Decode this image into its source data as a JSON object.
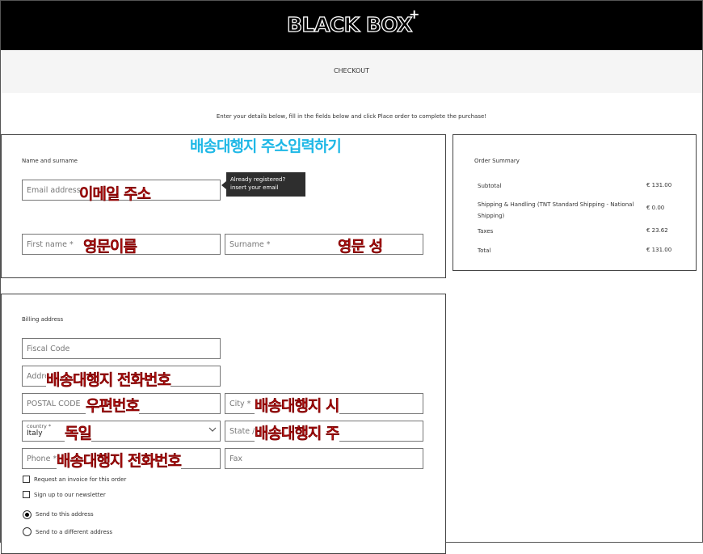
{
  "header": {
    "logo": "BLACK BOX",
    "logo_plus": "+"
  },
  "subbar": {
    "title": "CHECKOUT"
  },
  "intro": "Enter your details below, fill in the fields below and click Place order to complete the purchase!",
  "contact": {
    "section_label": "Name and surname",
    "email_placeholder": "Email address",
    "tooltip_line1": "Already registered?",
    "tooltip_line2": "insert your email",
    "first_name_placeholder": "First name *",
    "surname_placeholder": "Surname *"
  },
  "billing": {
    "section_label": "Billing address",
    "fiscal_code_placeholder": "Fiscal Code",
    "address_placeholder": "Addre",
    "postal_placeholder": "POSTAL CODE",
    "city_placeholder": "City *",
    "country_label": "country *",
    "country_value": "Italy",
    "state_placeholder": "State /",
    "phone_placeholder": "Phone *",
    "fax_placeholder": "Fax",
    "invoice_label": "Request an invoice for this order",
    "newsletter_label": "Sign up to our newsletter",
    "send_same_label": "Send to this address",
    "send_different_label": "Send to a different address"
  },
  "summary": {
    "title": "Order Summary",
    "rows": [
      {
        "label": "Subtotal",
        "value": "€ 131.00"
      },
      {
        "label": "Shipping & Handling (TNT Standard Shipping - National Shipping)",
        "value": "€ 0.00"
      },
      {
        "label": "Taxes",
        "value": "€ 23.62"
      },
      {
        "label": "Total",
        "value": "€ 131.00"
      }
    ]
  },
  "annotations": {
    "title": "배송대행지 주소입력하기",
    "email": "이메일 주소",
    "first_name": "영문이름",
    "surname": "영문 성",
    "phone_top": "배송대행지 전화번호",
    "postal": "우편번호",
    "city": "배송대행지 시",
    "country": "독일",
    "state": "배송대행지 주",
    "phone_bottom": "배송대행지 전화번호"
  },
  "colors": {
    "header_bg": "#000000",
    "annotation_red": "#e51b1b",
    "annotation_blue": "#1fb8e6"
  }
}
